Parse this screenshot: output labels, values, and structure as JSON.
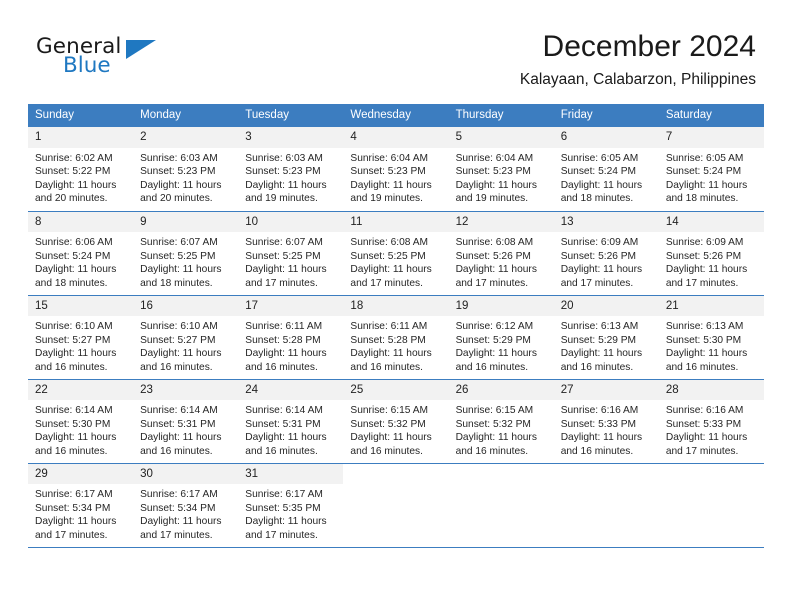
{
  "logo": {
    "word1": "General",
    "word2": "Blue",
    "triangle_color": "#1f78c1",
    "icon": "triangle-icon"
  },
  "header": {
    "title": "December 2024",
    "subtitle": "Kalayaan, Calabarzon, Philippines"
  },
  "calendar": {
    "header_bg": "#3c7dc0",
    "daynum_bg": "#f2f2f2",
    "weekday_headers": [
      "Sunday",
      "Monday",
      "Tuesday",
      "Wednesday",
      "Thursday",
      "Friday",
      "Saturday"
    ],
    "weeks": [
      [
        {
          "day": "1",
          "sunrise": "Sunrise: 6:02 AM",
          "sunset": "Sunset: 5:22 PM",
          "daylight1": "Daylight: 11 hours",
          "daylight2": "and 20 minutes."
        },
        {
          "day": "2",
          "sunrise": "Sunrise: 6:03 AM",
          "sunset": "Sunset: 5:23 PM",
          "daylight1": "Daylight: 11 hours",
          "daylight2": "and 20 minutes."
        },
        {
          "day": "3",
          "sunrise": "Sunrise: 6:03 AM",
          "sunset": "Sunset: 5:23 PM",
          "daylight1": "Daylight: 11 hours",
          "daylight2": "and 19 minutes."
        },
        {
          "day": "4",
          "sunrise": "Sunrise: 6:04 AM",
          "sunset": "Sunset: 5:23 PM",
          "daylight1": "Daylight: 11 hours",
          "daylight2": "and 19 minutes."
        },
        {
          "day": "5",
          "sunrise": "Sunrise: 6:04 AM",
          "sunset": "Sunset: 5:23 PM",
          "daylight1": "Daylight: 11 hours",
          "daylight2": "and 19 minutes."
        },
        {
          "day": "6",
          "sunrise": "Sunrise: 6:05 AM",
          "sunset": "Sunset: 5:24 PM",
          "daylight1": "Daylight: 11 hours",
          "daylight2": "and 18 minutes."
        },
        {
          "day": "7",
          "sunrise": "Sunrise: 6:05 AM",
          "sunset": "Sunset: 5:24 PM",
          "daylight1": "Daylight: 11 hours",
          "daylight2": "and 18 minutes."
        }
      ],
      [
        {
          "day": "8",
          "sunrise": "Sunrise: 6:06 AM",
          "sunset": "Sunset: 5:24 PM",
          "daylight1": "Daylight: 11 hours",
          "daylight2": "and 18 minutes."
        },
        {
          "day": "9",
          "sunrise": "Sunrise: 6:07 AM",
          "sunset": "Sunset: 5:25 PM",
          "daylight1": "Daylight: 11 hours",
          "daylight2": "and 18 minutes."
        },
        {
          "day": "10",
          "sunrise": "Sunrise: 6:07 AM",
          "sunset": "Sunset: 5:25 PM",
          "daylight1": "Daylight: 11 hours",
          "daylight2": "and 17 minutes."
        },
        {
          "day": "11",
          "sunrise": "Sunrise: 6:08 AM",
          "sunset": "Sunset: 5:25 PM",
          "daylight1": "Daylight: 11 hours",
          "daylight2": "and 17 minutes."
        },
        {
          "day": "12",
          "sunrise": "Sunrise: 6:08 AM",
          "sunset": "Sunset: 5:26 PM",
          "daylight1": "Daylight: 11 hours",
          "daylight2": "and 17 minutes."
        },
        {
          "day": "13",
          "sunrise": "Sunrise: 6:09 AM",
          "sunset": "Sunset: 5:26 PM",
          "daylight1": "Daylight: 11 hours",
          "daylight2": "and 17 minutes."
        },
        {
          "day": "14",
          "sunrise": "Sunrise: 6:09 AM",
          "sunset": "Sunset: 5:26 PM",
          "daylight1": "Daylight: 11 hours",
          "daylight2": "and 17 minutes."
        }
      ],
      [
        {
          "day": "15",
          "sunrise": "Sunrise: 6:10 AM",
          "sunset": "Sunset: 5:27 PM",
          "daylight1": "Daylight: 11 hours",
          "daylight2": "and 16 minutes."
        },
        {
          "day": "16",
          "sunrise": "Sunrise: 6:10 AM",
          "sunset": "Sunset: 5:27 PM",
          "daylight1": "Daylight: 11 hours",
          "daylight2": "and 16 minutes."
        },
        {
          "day": "17",
          "sunrise": "Sunrise: 6:11 AM",
          "sunset": "Sunset: 5:28 PM",
          "daylight1": "Daylight: 11 hours",
          "daylight2": "and 16 minutes."
        },
        {
          "day": "18",
          "sunrise": "Sunrise: 6:11 AM",
          "sunset": "Sunset: 5:28 PM",
          "daylight1": "Daylight: 11 hours",
          "daylight2": "and 16 minutes."
        },
        {
          "day": "19",
          "sunrise": "Sunrise: 6:12 AM",
          "sunset": "Sunset: 5:29 PM",
          "daylight1": "Daylight: 11 hours",
          "daylight2": "and 16 minutes."
        },
        {
          "day": "20",
          "sunrise": "Sunrise: 6:13 AM",
          "sunset": "Sunset: 5:29 PM",
          "daylight1": "Daylight: 11 hours",
          "daylight2": "and 16 minutes."
        },
        {
          "day": "21",
          "sunrise": "Sunrise: 6:13 AM",
          "sunset": "Sunset: 5:30 PM",
          "daylight1": "Daylight: 11 hours",
          "daylight2": "and 16 minutes."
        }
      ],
      [
        {
          "day": "22",
          "sunrise": "Sunrise: 6:14 AM",
          "sunset": "Sunset: 5:30 PM",
          "daylight1": "Daylight: 11 hours",
          "daylight2": "and 16 minutes."
        },
        {
          "day": "23",
          "sunrise": "Sunrise: 6:14 AM",
          "sunset": "Sunset: 5:31 PM",
          "daylight1": "Daylight: 11 hours",
          "daylight2": "and 16 minutes."
        },
        {
          "day": "24",
          "sunrise": "Sunrise: 6:14 AM",
          "sunset": "Sunset: 5:31 PM",
          "daylight1": "Daylight: 11 hours",
          "daylight2": "and 16 minutes."
        },
        {
          "day": "25",
          "sunrise": "Sunrise: 6:15 AM",
          "sunset": "Sunset: 5:32 PM",
          "daylight1": "Daylight: 11 hours",
          "daylight2": "and 16 minutes."
        },
        {
          "day": "26",
          "sunrise": "Sunrise: 6:15 AM",
          "sunset": "Sunset: 5:32 PM",
          "daylight1": "Daylight: 11 hours",
          "daylight2": "and 16 minutes."
        },
        {
          "day": "27",
          "sunrise": "Sunrise: 6:16 AM",
          "sunset": "Sunset: 5:33 PM",
          "daylight1": "Daylight: 11 hours",
          "daylight2": "and 16 minutes."
        },
        {
          "day": "28",
          "sunrise": "Sunrise: 6:16 AM",
          "sunset": "Sunset: 5:33 PM",
          "daylight1": "Daylight: 11 hours",
          "daylight2": "and 17 minutes."
        }
      ],
      [
        {
          "day": "29",
          "sunrise": "Sunrise: 6:17 AM",
          "sunset": "Sunset: 5:34 PM",
          "daylight1": "Daylight: 11 hours",
          "daylight2": "and 17 minutes."
        },
        {
          "day": "30",
          "sunrise": "Sunrise: 6:17 AM",
          "sunset": "Sunset: 5:34 PM",
          "daylight1": "Daylight: 11 hours",
          "daylight2": "and 17 minutes."
        },
        {
          "day": "31",
          "sunrise": "Sunrise: 6:17 AM",
          "sunset": "Sunset: 5:35 PM",
          "daylight1": "Daylight: 11 hours",
          "daylight2": "and 17 minutes."
        },
        {
          "day": "",
          "sunrise": "",
          "sunset": "",
          "daylight1": "",
          "daylight2": ""
        },
        {
          "day": "",
          "sunrise": "",
          "sunset": "",
          "daylight1": "",
          "daylight2": ""
        },
        {
          "day": "",
          "sunrise": "",
          "sunset": "",
          "daylight1": "",
          "daylight2": ""
        },
        {
          "day": "",
          "sunrise": "",
          "sunset": "",
          "daylight1": "",
          "daylight2": ""
        }
      ]
    ]
  }
}
